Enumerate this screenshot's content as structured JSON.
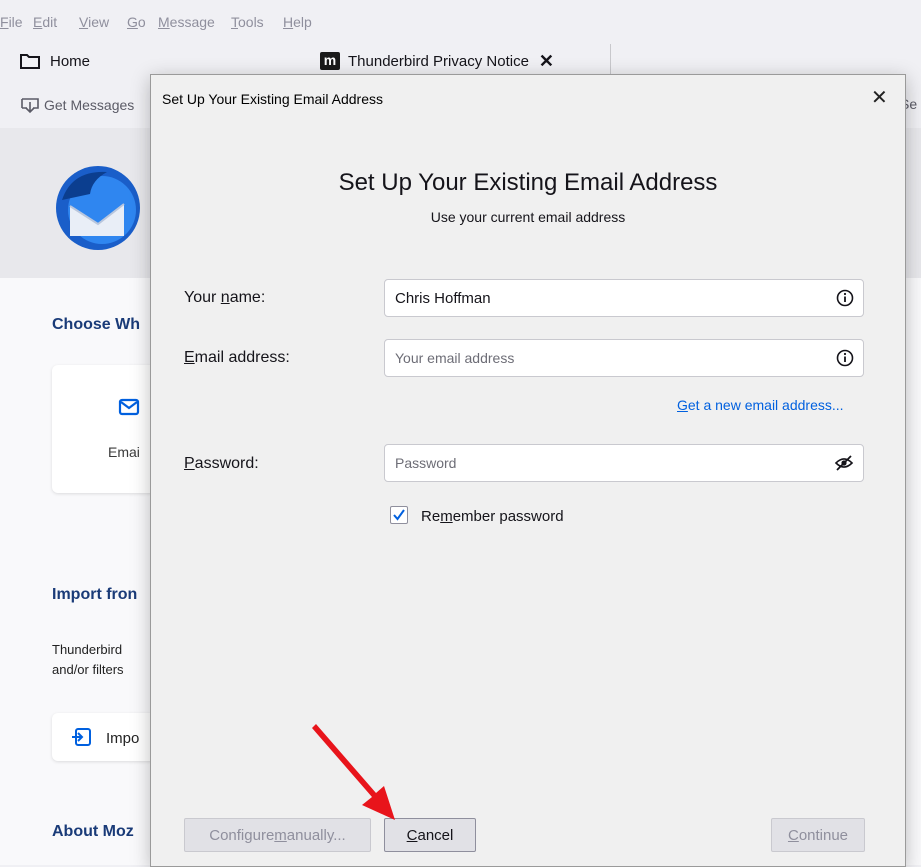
{
  "menu": [
    {
      "pre": "",
      "ul": "F",
      "post": "ile"
    },
    {
      "pre": "",
      "ul": "E",
      "post": "dit"
    },
    {
      "pre": "",
      "ul": "V",
      "post": "iew"
    },
    {
      "pre": "",
      "ul": "G",
      "post": "o"
    },
    {
      "pre": "",
      "ul": "M",
      "post": "essage"
    },
    {
      "pre": "",
      "ul": "T",
      "post": "ools"
    },
    {
      "pre": "",
      "ul": "H",
      "post": "elp"
    }
  ],
  "tabs": {
    "home_label": "Home",
    "privacy_logo": "m",
    "privacy_label": "Thunderbird Privacy Notice"
  },
  "toolbar": {
    "get_messages": "Get Messages",
    "search_fragment": "Se"
  },
  "background": {
    "choose_heading": "Choose Wh",
    "card_label": "Emai",
    "import_heading": "Import fron",
    "import_text_line1": "Thunderbird",
    "import_text_line2": "and/or filters",
    "import_button": "Impo",
    "about_heading": "About Moz"
  },
  "dialog": {
    "window_title": "Set Up Your Existing Email Address",
    "heading": "Set Up Your Existing Email Address",
    "subheading": "Use your current email address",
    "name_label_pre": "Your ",
    "name_label_ul": "n",
    "name_label_post": "ame:",
    "name_value": "Chris Hoffman",
    "email_label_ul": "E",
    "email_label_post": "mail address:",
    "email_placeholder": "Your email address",
    "new_email_link_ul": "G",
    "new_email_link_post": "et a new email address...",
    "password_label_ul": "P",
    "password_label_post": "assword:",
    "password_placeholder": "Password",
    "remember_pre": "Re",
    "remember_ul": "m",
    "remember_post": "ember password",
    "remember_checked": true,
    "configure_pre": "Configure ",
    "configure_ul": "m",
    "configure_post": "anually...",
    "cancel_pre": "",
    "cancel_ul": "C",
    "cancel_post": "ancel",
    "continue_ul": "C",
    "continue_post": "ontinue"
  },
  "colors": {
    "link": "#0060df",
    "heading_blue": "#1a3b78",
    "arrow_red": "#e8141b"
  }
}
